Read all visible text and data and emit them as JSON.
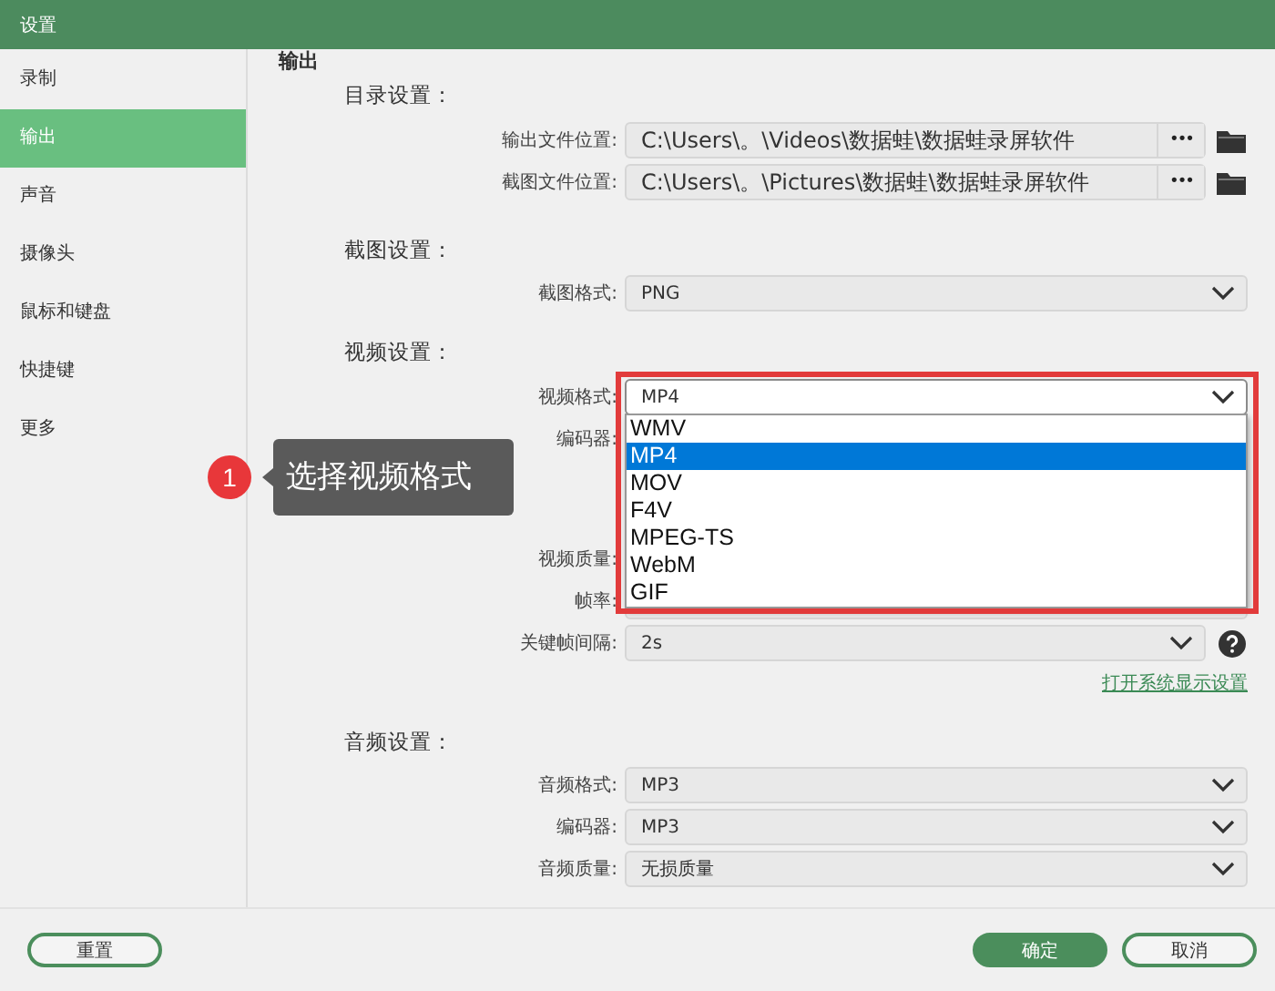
{
  "window": {
    "title": "设置"
  },
  "sidebar": {
    "items": [
      {
        "label": "录制",
        "selected": false
      },
      {
        "label": "输出",
        "selected": true
      },
      {
        "label": "声音",
        "selected": false
      },
      {
        "label": "摄像头",
        "selected": false
      },
      {
        "label": "鼠标和键盘",
        "selected": false
      },
      {
        "label": "快捷键",
        "selected": false
      },
      {
        "label": "更多",
        "selected": false
      }
    ]
  },
  "content": {
    "heading": "输出",
    "sections": [
      {
        "title": "目录设置：",
        "rows": [
          {
            "kind": "path",
            "label": "输出文件位置:",
            "value": "C:\\Users\\。\\Videos\\数据蛙\\数据蛙录屏软件",
            "button": "•••"
          },
          {
            "kind": "path",
            "label": "截图文件位置:",
            "value": "C:\\Users\\。\\Pictures\\数据蛙\\数据蛙录屏软件",
            "button": "•••"
          }
        ]
      },
      {
        "title": "截图设置：",
        "rows": [
          {
            "kind": "select",
            "label": "截图格式:",
            "value": "PNG"
          }
        ]
      },
      {
        "title": "视频设置：",
        "rows": [
          {
            "kind": "select",
            "label": "视频格式:",
            "value": "MP4",
            "open": true,
            "highlight": true,
            "options": [
              {
                "label": "WMV",
                "selected": false
              },
              {
                "label": "MP4",
                "selected": true
              },
              {
                "label": "MOV",
                "selected": false
              },
              {
                "label": "F4V",
                "selected": false
              },
              {
                "label": "MPEG-TS",
                "selected": false
              },
              {
                "label": "WebM",
                "selected": false
              },
              {
                "label": "GIF",
                "selected": false
              }
            ]
          },
          {
            "kind": "label",
            "label": "编码器:"
          },
          {
            "kind": "label",
            "label": "视频质量:"
          },
          {
            "kind": "select",
            "label": "帧率:"
          },
          {
            "kind": "select",
            "label": "关键帧间隔:",
            "value": "2s",
            "help": true
          }
        ],
        "link": "打开系统显示设置"
      },
      {
        "title": "音频设置：",
        "rows": [
          {
            "kind": "select",
            "label": "音频格式:",
            "value": "MP3"
          },
          {
            "kind": "select",
            "label": "编码器:",
            "value": "MP3"
          },
          {
            "kind": "select",
            "label": "音频质量:",
            "value": "无损质量"
          }
        ]
      }
    ]
  },
  "callout": {
    "number": "1",
    "text": "选择视频格式"
  },
  "footer": {
    "buttons": [
      {
        "label": "重置",
        "kind": "outline"
      },
      {
        "label": "确定",
        "kind": "primary"
      },
      {
        "label": "取消",
        "kind": "outline"
      }
    ]
  }
}
